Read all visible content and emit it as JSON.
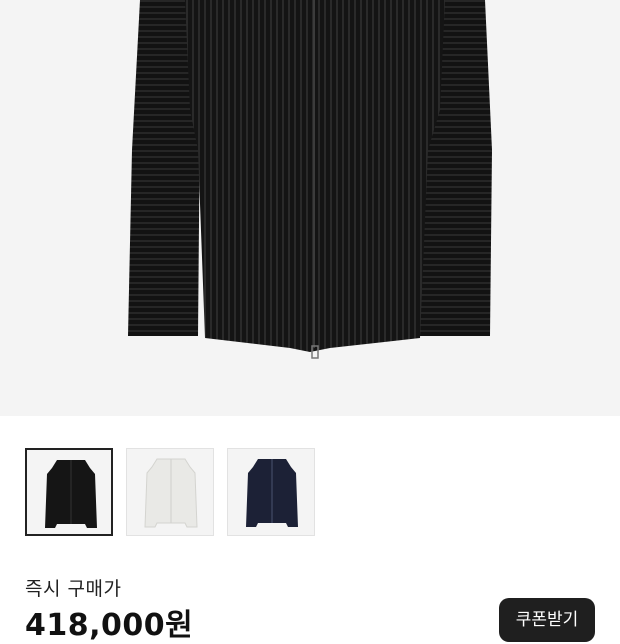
{
  "product": {
    "main_image": "black-pleated-zip-jacket",
    "thumbnails": [
      {
        "variant": "black-jacket",
        "color": "#151515",
        "selected": true
      },
      {
        "variant": "white-jacket",
        "color": "#e9e9e6",
        "selected": false
      },
      {
        "variant": "navy-jacket",
        "color": "#1c2136",
        "selected": false
      }
    ]
  },
  "purchase": {
    "label": "즉시 구매가",
    "price": "418,000원",
    "coupon_button": "쿠폰받기"
  },
  "colors": {
    "background": "#ffffff",
    "image_background": "#f4f4f4",
    "button_background": "#1f1f1f",
    "text": "#222222"
  }
}
